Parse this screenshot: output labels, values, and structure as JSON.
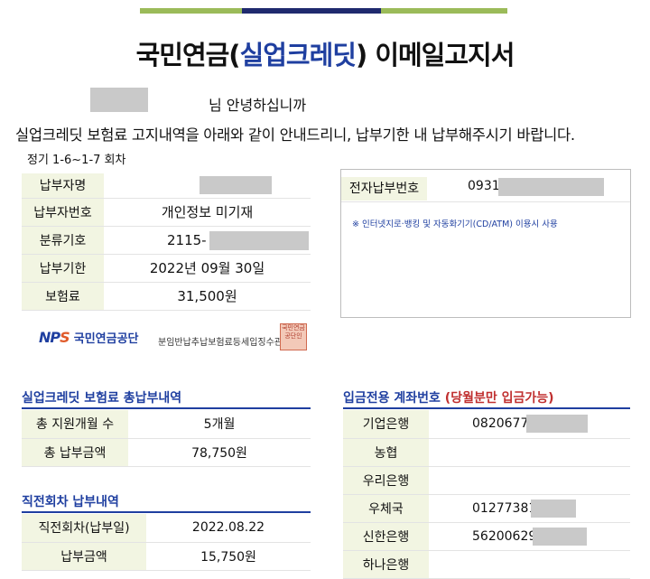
{
  "colors": {
    "accent_blue": "#1f3fa0",
    "label_bg": "#f2f5e2",
    "deadline_red": "#c03030",
    "bar_green": "#9bbb59",
    "bar_navy": "#1f2a6e"
  },
  "header": {
    "title_prefix": "국민연금(",
    "title_highlight": "실업크레딧",
    "title_suffix": ") 이메일고지서"
  },
  "greeting": "님 안녕하십니까",
  "intro": "실업크레딧 보험료 고지내역을 아래와 같이 안내드리니, 납부기한 내 납부해주시기 바랍니다.",
  "round": "정기 1-6~1-7 회차",
  "billing": [
    {
      "label": "납부자명",
      "value": ""
    },
    {
      "label": "납부자번호",
      "value": "개인정보 미기재"
    },
    {
      "label": "분류기호",
      "value": "2115-"
    },
    {
      "label": "납부기한",
      "value": "2022년 09월 30일"
    },
    {
      "label": "보험료",
      "value": "31,500원"
    }
  ],
  "epay": {
    "label": "전자납부번호",
    "value": "0931",
    "note": "※ 인터넷지로·뱅킹 및 자동화기기(CD/ATM) 이용시 사용"
  },
  "logo": {
    "nps_n": "N",
    "nps_p": "P",
    "nps_s": "S",
    "org": "국민연금공단",
    "sub": "분임반납추납보험료등세입징수관",
    "seal": "국민연금공단인"
  },
  "total": {
    "title": "실업크레딧 보험료 총납부내역",
    "rows": [
      {
        "label": "총 지원개월 수",
        "value": "5개월"
      },
      {
        "label": "총 납부금액",
        "value": "78,750원"
      }
    ]
  },
  "previous": {
    "title": "직전회차 납부내역",
    "rows": [
      {
        "label": "직전회차(납부일)",
        "value": "2022.08.22"
      },
      {
        "label": "납부금액",
        "value": "15,750원"
      }
    ]
  },
  "deposit": {
    "title": "입금전용 계좌번호 ",
    "title_note": "(당월분만 입금가능)",
    "rows": [
      {
        "label": "기업은행",
        "value": "0820677"
      },
      {
        "label": "농협",
        "value": ""
      },
      {
        "label": "우리은행",
        "value": ""
      },
      {
        "label": "우체국",
        "value": "01277381"
      },
      {
        "label": "신한은행",
        "value": "56200629"
      },
      {
        "label": "하나은행",
        "value": ""
      }
    ]
  }
}
